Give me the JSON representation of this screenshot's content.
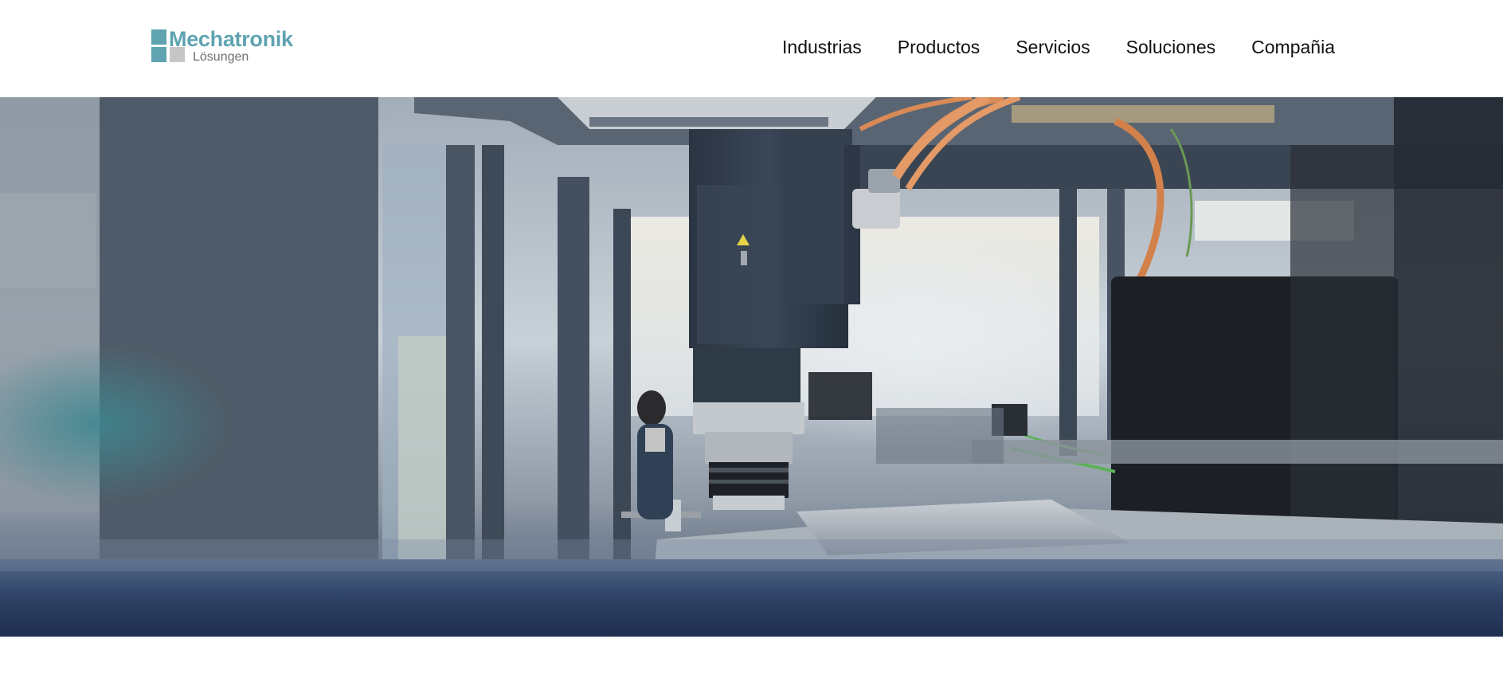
{
  "brand": {
    "name": "Mechatronik",
    "tagline": "Lösungen",
    "primary_color": "#5fa3b0",
    "secondary_color": "#c6c6c6"
  },
  "nav": {
    "items": [
      {
        "id": "industrias",
        "label": "Industrias"
      },
      {
        "id": "productos",
        "label": "Productos"
      },
      {
        "id": "servicios",
        "label": "Servicios"
      },
      {
        "id": "soluciones",
        "label": "Soluciones"
      },
      {
        "id": "compania",
        "label": "Compañia"
      }
    ]
  },
  "hero": {
    "image": "factory-automation-servo-motor-photo"
  }
}
